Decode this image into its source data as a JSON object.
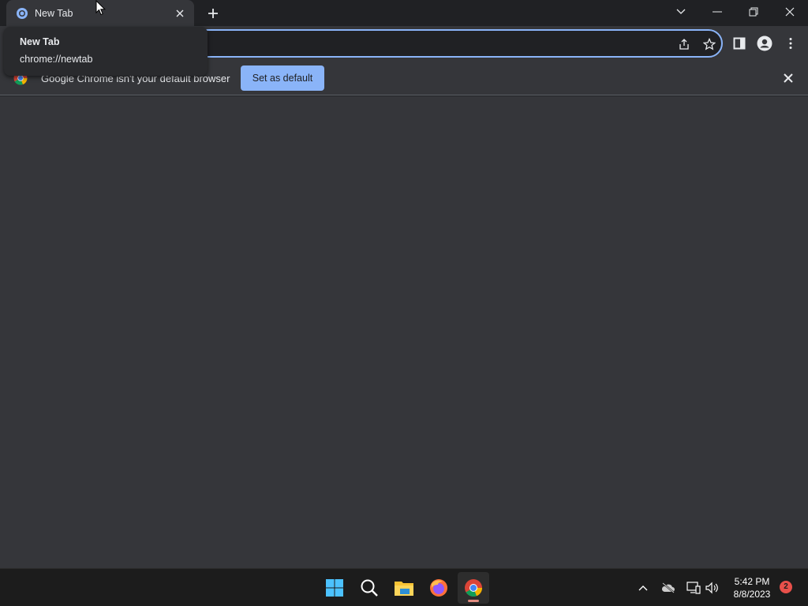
{
  "browser": {
    "tab": {
      "title": "New Tab",
      "favicon": "chrome-newtab-icon"
    },
    "tooltip": {
      "title": "New Tab",
      "url": "chrome://newtab"
    },
    "omnibox": {
      "value": ""
    },
    "infobar": {
      "message": "Google Chrome isn't your default browser",
      "button_label": "Set as default"
    }
  },
  "taskbar": {
    "apps": [
      "start",
      "search",
      "file-explorer",
      "firefox",
      "chrome"
    ],
    "active_app": "chrome",
    "clock": {
      "time": "5:42 PM",
      "date": "8/8/2023"
    },
    "notification_count": "2"
  },
  "colors": {
    "accent": "#8ab4f8",
    "frame": "#202124",
    "toolbar": "#35363a",
    "taskbar": "#1c1c1c"
  }
}
